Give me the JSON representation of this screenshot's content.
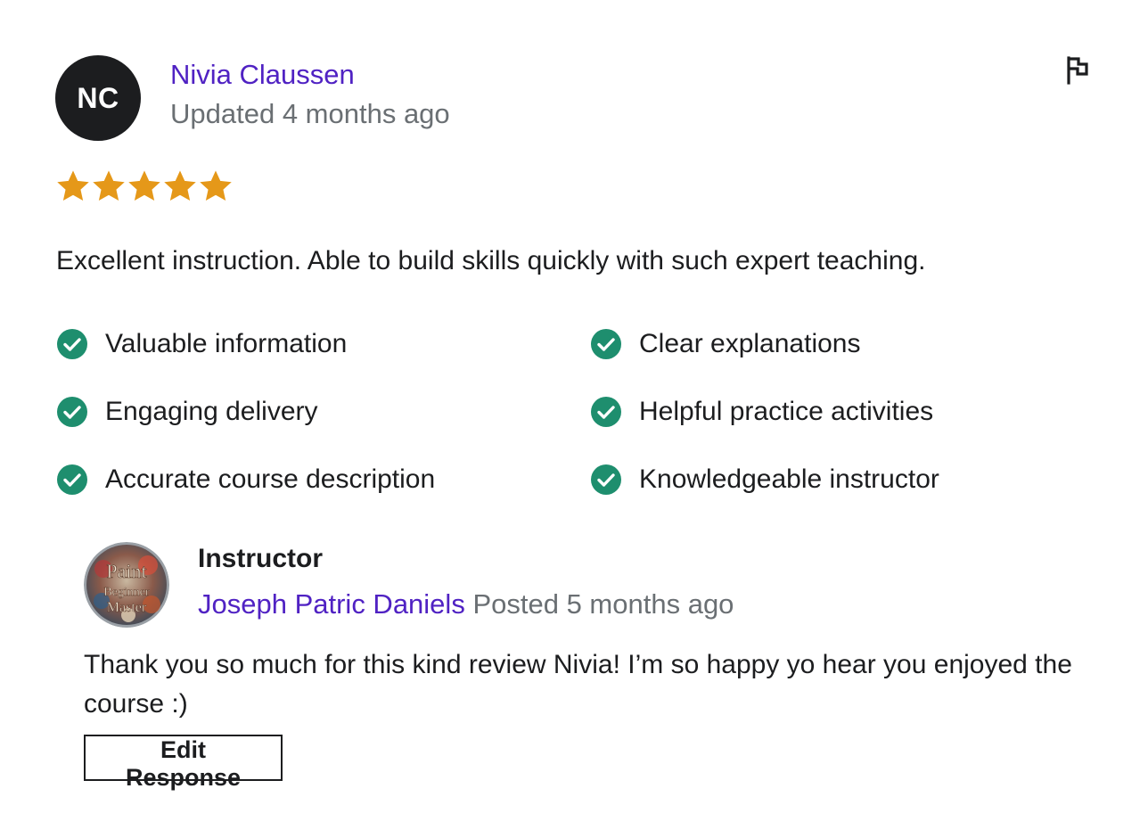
{
  "review": {
    "avatar_initials": "NC",
    "reviewer_name": "Nivia Claussen",
    "updated_text": "Updated 4 months ago",
    "rating": 5,
    "rating_max": 5,
    "text": "Excellent instruction. Able to build skills quickly with such expert teaching.",
    "flag_icon": "flag-icon",
    "colors": {
      "star": "#e59819",
      "check": "#1e8e6e",
      "link": "#5022c3",
      "muted": "#6a6f73",
      "avatar_bg": "#1c1d1f"
    },
    "qualities": [
      {
        "label": "Valuable information"
      },
      {
        "label": "Clear explanations"
      },
      {
        "label": "Engaging delivery"
      },
      {
        "label": "Helpful practice activities"
      },
      {
        "label": "Accurate course description"
      },
      {
        "label": "Knowledgeable instructor"
      }
    ]
  },
  "response": {
    "role_label": "Instructor",
    "instructor_name": "Joseph Patric Daniels",
    "posted_text": "Posted 5 months ago",
    "text": "Thank you so much for this kind review Nivia! I’m so happy yo hear you enjoyed the course :)",
    "edit_button_label": "Edit Response",
    "avatar_text": [
      "Paint",
      "Beginner",
      "Master"
    ]
  }
}
